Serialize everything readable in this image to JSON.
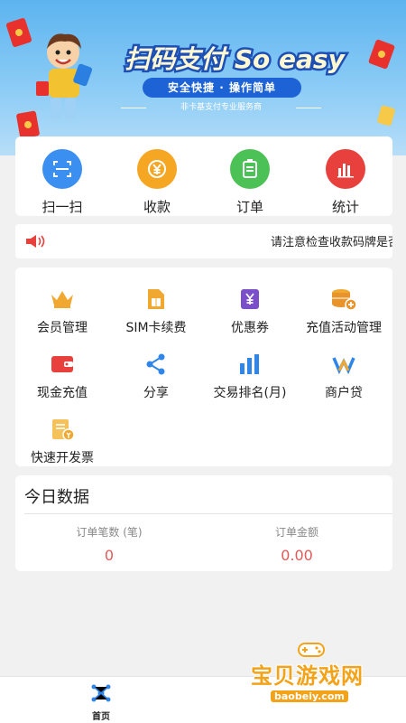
{
  "banner": {
    "headline": "扫码支付 So easy",
    "tagline": "安全快捷 · 操作简单",
    "subline": "非卡基支付专业服务商"
  },
  "quick_actions": [
    {
      "label": "扫一扫",
      "icon": "scan-icon",
      "color": "#3a8ff0"
    },
    {
      "label": "收款",
      "icon": "yen-collect-icon",
      "color": "#f5a623"
    },
    {
      "label": "订单",
      "icon": "order-list-icon",
      "color": "#4cc256"
    },
    {
      "label": "统计",
      "icon": "bar-stats-icon",
      "color": "#e8403c"
    }
  ],
  "notice": {
    "icon": "speaker-icon",
    "text": "请注意检查收款码牌是否被更换"
  },
  "features": [
    {
      "label": "会员管理",
      "icon": "crown-icon"
    },
    {
      "label": "SIM卡续费",
      "icon": "sim-card-icon"
    },
    {
      "label": "优惠券",
      "icon": "coupon-icon"
    },
    {
      "label": "充值活动管理",
      "icon": "coins-add-icon"
    },
    {
      "label": "现金充值",
      "icon": "wallet-icon"
    },
    {
      "label": "分享",
      "icon": "share-icon"
    },
    {
      "label": "交易排名(月)",
      "icon": "ranking-bars-icon"
    },
    {
      "label": "商户贷",
      "icon": "merchant-loan-icon"
    },
    {
      "label": "快速开发票",
      "icon": "invoice-icon"
    }
  ],
  "today_data": {
    "title": "今日数据",
    "order_count_label": "订单笔数 (笔)",
    "order_count_value": "0",
    "order_amount_label": "订单金额",
    "order_amount_value": "0.00"
  },
  "tabbar": {
    "home_label": "首页"
  },
  "watermark": {
    "title": "宝贝游戏网",
    "url": "baobeiy.com"
  }
}
